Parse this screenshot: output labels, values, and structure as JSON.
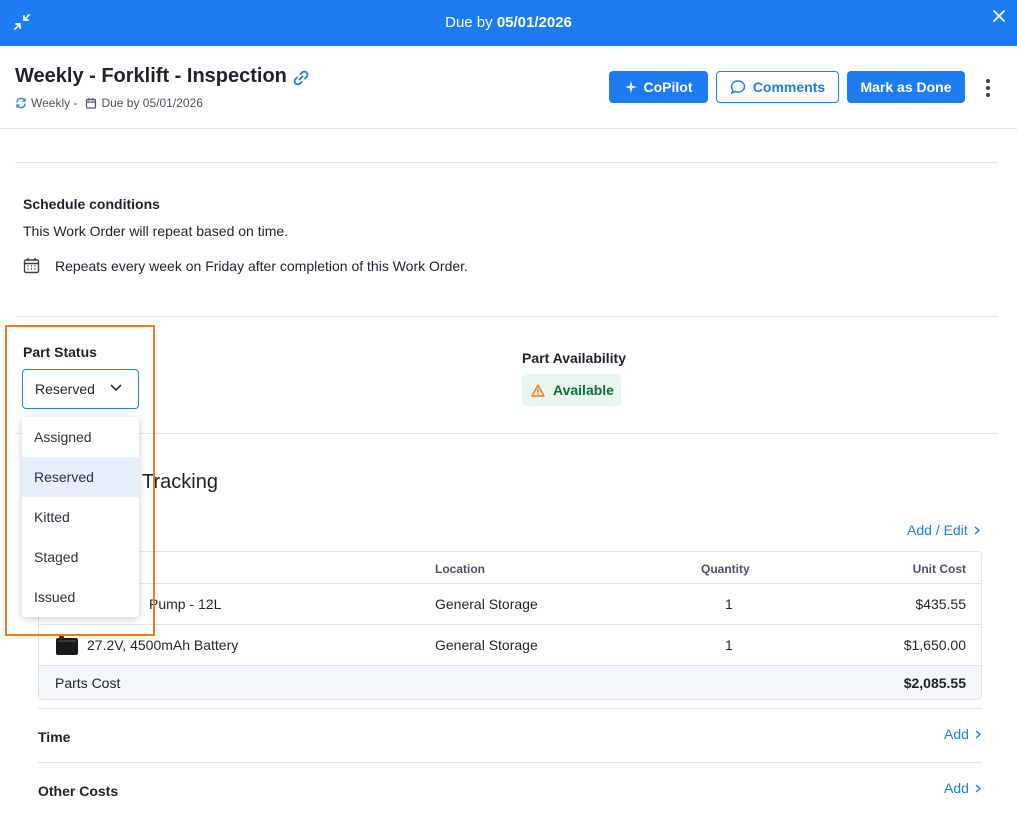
{
  "topbar": {
    "due_prefix": "Due by ",
    "due_date": "05/01/2026",
    "collapse_icon": "collapse-icon",
    "close_icon": "close-icon"
  },
  "header": {
    "title": "Weekly - Forklift - Inspection",
    "recurrence": "Weekly -",
    "due": "Due by 05/01/2026",
    "copilot_label": "CoPilot",
    "comments_label": "Comments",
    "done_label": "Mark as Done"
  },
  "schedule": {
    "title": "Schedule conditions",
    "description": "This Work Order will repeat based on time.",
    "repeat_text": "Repeats every week on Friday after completion of this Work Order."
  },
  "part_status": {
    "label": "Part Status",
    "selected": "Reserved",
    "options": [
      "Assigned",
      "Reserved",
      "Kitted",
      "Staged",
      "Issued"
    ]
  },
  "part_availability": {
    "label": "Part Availability",
    "value": "Available"
  },
  "tracking": {
    "title": "Tracking",
    "add_edit_label": "Add / Edit"
  },
  "parts_table": {
    "headers": {
      "location": "Location",
      "quantity": "Quantity",
      "unit_cost": "Unit Cost"
    },
    "rows": [
      {
        "name": "Pump - 12L",
        "location": "General Storage",
        "quantity": "1",
        "unit_cost": "$435.55"
      },
      {
        "name": "27.2V, 4500mAh Battery",
        "location": "General Storage",
        "quantity": "1",
        "unit_cost": "$1,650.00"
      }
    ],
    "total_label": "Parts Cost",
    "total_value": "$2,085.55"
  },
  "time": {
    "label": "Time",
    "add_label": "Add"
  },
  "other_costs": {
    "label": "Other Costs",
    "add_label": "Add"
  },
  "colors": {
    "primary": "#1d7cf2",
    "highlight": "#f07b18",
    "available_bg": "#e8f6ec",
    "available_text": "#0f6f3c"
  }
}
